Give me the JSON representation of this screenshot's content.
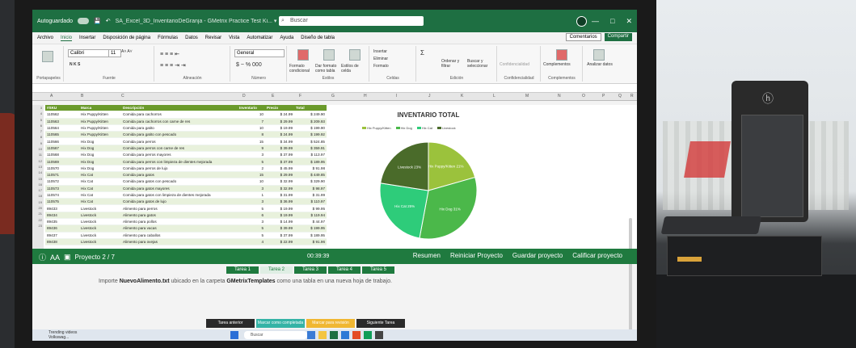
{
  "window": {
    "autosave": "Autoguardado",
    "title": "SA_Excel_3D_InventarioDeGranja - GMetrix Practice Test Ki... ▾",
    "search_placeholder": "Buscar",
    "min": "—",
    "max": "□",
    "close": "✕"
  },
  "menu": {
    "items": [
      "Archivo",
      "Inicio",
      "Insertar",
      "Disposición de página",
      "Fórmulas",
      "Datos",
      "Revisar",
      "Vista",
      "Automatizar",
      "Ayuda",
      "Diseño de tabla"
    ],
    "comments_label": "Comentarios",
    "share_label": "Compartir"
  },
  "ribbon": {
    "groups": [
      "Portapapeles",
      "Fuente",
      "Alineación",
      "Número",
      "Estilos",
      "Celdas",
      "Edición",
      "Confidencialidad",
      "Complementos"
    ],
    "font_name": "Calibri",
    "font_size": "11",
    "number_format": "General",
    "styles": [
      "Formato condicional",
      "Dar formato como tabla",
      "Estilos de celda"
    ],
    "cells": [
      "Insertar",
      "Eliminar",
      "Formato"
    ],
    "editing": [
      "Ordenar y filtrar",
      "Buscar y seleccionar"
    ],
    "extras": [
      "Confidencialidad",
      "Complementos",
      "Analizar datos"
    ]
  },
  "columns": [
    "A",
    "B",
    "C",
    "D",
    "E",
    "F",
    "G",
    "H",
    "I",
    "J",
    "K",
    "L",
    "M",
    "N",
    "O",
    "P",
    "Q",
    "R"
  ],
  "table": {
    "headers": [
      "#SKU",
      "Marca",
      "Descripción",
      "Inventario",
      "Precio",
      "Total"
    ],
    "rows": [
      [
        "110562",
        "Hix Puppy/Kitten",
        "Comida para cachorros",
        "10",
        "$ 24.99",
        "$ 249.90"
      ],
      [
        "110563",
        "Hix Puppy/Kitten",
        "Comida para cachorros con carne de res",
        "7",
        "$ 29.99",
        "$ 209.93"
      ],
      [
        "110564",
        "Hix Puppy/Kitten",
        "Comida para gatito",
        "10",
        "$ 19.99",
        "$ 199.90"
      ],
      [
        "110565",
        "Hix Puppy/Kitten",
        "Comida para gatito con pescado",
        "8",
        "$ 24.99",
        "$ 199.92"
      ],
      [
        "110566",
        "Hix Dog",
        "Comida para perros",
        "15",
        "$ 34.99",
        "$ 524.85"
      ],
      [
        "110567",
        "Hix Dog",
        "Comida para perros con carne de res",
        "9",
        "$ 39.99",
        "$ 359.91"
      ],
      [
        "110568",
        "Hix Dog",
        "Comida para perros mayores",
        "3",
        "$ 37.99",
        "$ 113.97"
      ],
      [
        "110569",
        "Hix Dog",
        "Comida para perros con limpieza de dientes mejorada",
        "5",
        "$ 37.99",
        "$ 189.95"
      ],
      [
        "110570",
        "Hix Dog",
        "Comida para perros de lujo",
        "2",
        "$ 45.99",
        "$ 91.98"
      ],
      [
        "110571",
        "Hix Cat",
        "Comida para gatos",
        "15",
        "$ 29.99",
        "$ 449.85"
      ],
      [
        "110572",
        "Hix Cat",
        "Comida para gatos con pescado",
        "10",
        "$ 32.99",
        "$ 329.90"
      ],
      [
        "110573",
        "Hix Cat",
        "Comida para gatos mayores",
        "3",
        "$ 32.99",
        "$ 98.97"
      ],
      [
        "110574",
        "Hix Cat",
        "Comida para gatos con limpieza de dientes mejorada",
        "1",
        "$ 31.99",
        "$ 31.99"
      ],
      [
        "110575",
        "Hix Cat",
        "Comida para gatos de lujo",
        "3",
        "$ 36.99",
        "$ 110.97"
      ],
      [
        "89433",
        "Livestock",
        "Alimento para perros",
        "5",
        "$ 19.99",
        "$ 99.95"
      ],
      [
        "89434",
        "Livestock",
        "Alimento para gatos",
        "6",
        "$ 19.99",
        "$ 119.94"
      ],
      [
        "89435",
        "Livestock",
        "Alimento para pollos",
        "3",
        "$ 14.99",
        "$ 44.97"
      ],
      [
        "89436",
        "Livestock",
        "Alimento para vacas",
        "5",
        "$ 39.99",
        "$ 199.95"
      ],
      [
        "89437",
        "Livestock",
        "Alimento para caballos",
        "5",
        "$ 37.99",
        "$ 189.95"
      ],
      [
        "89438",
        "Livestock",
        "Alimento para ovejas",
        "4",
        "$ 22.99",
        "$ 91.96"
      ]
    ]
  },
  "chart_data": {
    "type": "pie",
    "title": "INVENTARIO TOTAL",
    "categories": [
      "Hix Puppy/Kitten",
      "Hix Dog",
      "Hix Cat",
      "Livestock"
    ],
    "values": [
      21,
      33,
      25,
      23
    ],
    "slice_labels": [
      "Hix Puppy/Kitten 21%",
      "Hix Dog 31%",
      "Hix Cat 25%",
      "Livestock 23%"
    ],
    "colors": [
      "#9bc23c",
      "#4bb84a",
      "#2ecc7a",
      "#4a6b2a"
    ],
    "legend_position": "top"
  },
  "gmetrix": {
    "project": "Proyecto 2 / 7",
    "timer": "00:39:39",
    "actions": [
      "Resumen",
      "Reiniciar Proyecto",
      "Guardar proyecto",
      "Calificar proyecto"
    ],
    "tabs": [
      "Tarea 1",
      "Tarea 2",
      "Tarea 3",
      "Tarea 4",
      "Tarea 5"
    ],
    "active_tab": 1,
    "instruction_pre": "Importe ",
    "instruction_file": "NuevoAlimento.txt",
    "instruction_mid": " ubicado en la carpeta ",
    "instruction_folder": "GMetrixTemplates",
    "instruction_post": " como una tabla en una nueva hoja de trabajo.",
    "buttons": [
      "Tarea anterior",
      "Marcar como completada",
      "Marcar para revisión",
      "Siguiente Tarea"
    ],
    "button_colors": [
      "#2a2a2a",
      "#35b3a6",
      "#f0b732",
      "#2a2a2a"
    ]
  },
  "taskbar": {
    "news_title": "Trending videos",
    "news_sub": "Volkswag...",
    "search": "Buscar"
  }
}
